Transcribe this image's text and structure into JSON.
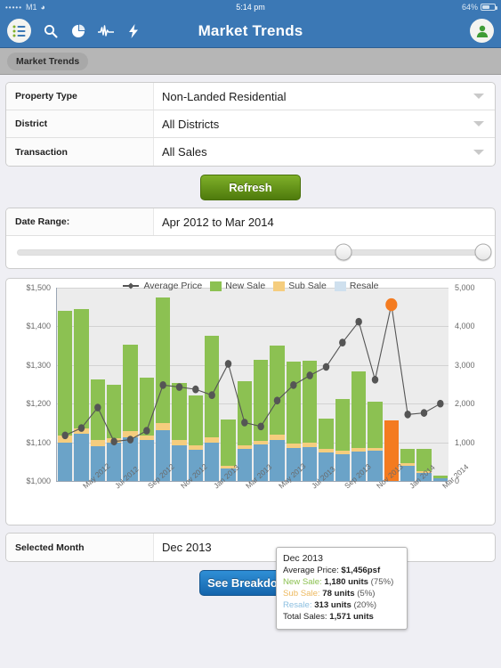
{
  "statusbar": {
    "signal_dots": "•••••",
    "carrier": "M1",
    "wifi_icon": "wifi-icon",
    "time": "5:14 pm",
    "battery_percent": "64%",
    "battery_level": 64
  },
  "navbar": {
    "title": "Market Trends",
    "menu_icon": "list-menu-icon",
    "icons": [
      {
        "name": "search-icon"
      },
      {
        "name": "pie-chart-icon"
      },
      {
        "name": "activity-pulse-icon"
      },
      {
        "name": "lightning-bolt-icon"
      }
    ],
    "avatar_icon": "user-avatar-icon",
    "bg_color": "#3b78b5"
  },
  "breadcrumb": {
    "label": "Market Trends"
  },
  "filters": {
    "rows": [
      {
        "label": "Property Type",
        "value": "Non-Landed Residential"
      },
      {
        "label": "District",
        "value": "All Districts"
      },
      {
        "label": "Transaction",
        "value": "All Sales"
      }
    ]
  },
  "refresh_button": {
    "label": "Refresh",
    "color": "#7fb029"
  },
  "date_range": {
    "label": "Date Range:",
    "value": "Apr 2012 to Mar 2014",
    "slider_left_percent": 70,
    "slider_right_percent": 100
  },
  "tooltip": {
    "month": "Dec 2013",
    "average_price_label": "Average Price:",
    "average_price_value": "$1,456psf",
    "new_sale_label": "New Sale:",
    "new_sale_value": "1,180 units",
    "new_sale_pct": "(75%)",
    "sub_sale_label": "Sub Sale:",
    "sub_sale_value": "78 units",
    "sub_sale_pct": "(5%)",
    "resale_label": "Resale:",
    "resale_value": "313 units",
    "resale_pct": "(20%)",
    "total_label": "Total Sales:",
    "total_value": "1,571 units"
  },
  "selected_month": {
    "label": "Selected Month",
    "value": "Dec 2013"
  },
  "breakdown_button": {
    "label": "See Breakdown",
    "color": "#1f7ec4"
  },
  "chart_data": {
    "type": "bar",
    "title": "",
    "xlabel": "",
    "ylabel": "",
    "y_left": {
      "ticks": [
        "$1,000",
        "$1,100",
        "$1,200",
        "$1,300",
        "$1,400",
        "$1,500"
      ],
      "min": 1000,
      "max": 1500
    },
    "y_right": {
      "ticks": [
        "0",
        "1,000",
        "2,000",
        "3,000",
        "4,000",
        "5,000"
      ],
      "min": 0,
      "max": 5000
    },
    "grid": true,
    "legend_position": "top-center",
    "legend": [
      {
        "name": "Average Price",
        "color": "#555555",
        "kind": "line"
      },
      {
        "name": "New Sale",
        "color": "#8cc152",
        "kind": "bar"
      },
      {
        "name": "Sub Sale",
        "color": "#f5cd7e",
        "kind": "bar"
      },
      {
        "name": "Resale",
        "color": "#cfe0ee",
        "kind": "bar"
      }
    ],
    "highlight_color": "#f47b20",
    "highlight_category": "Dec 2013",
    "categories": [
      "Apr 2012",
      "May 2012",
      "Jun 2012",
      "Jul 2012",
      "Aug 2012",
      "Sep 2012",
      "Oct 2012",
      "Nov 2012",
      "Dec 2012",
      "Jan 2013",
      "Feb 2013",
      "Mar 2013",
      "Apr 2013",
      "May 2013",
      "Jun 2013",
      "Jul 2013",
      "Aug 2013",
      "Sep 2013",
      "Oct 2013",
      "Nov 2013",
      "Dec 2013",
      "Jan 2014",
      "Feb 2014",
      "Mar 2014"
    ],
    "x_tick_labels": [
      "May 2012",
      "Jul 2012",
      "Sep 2012",
      "Nov 2012",
      "Jan 2013",
      "Mar 2013",
      "May 2013",
      "Jul 2013",
      "Sep 2013",
      "Nov 2013",
      "Jan 2014",
      "Mar 2014"
    ],
    "x_tick_indices": [
      1,
      3,
      5,
      7,
      9,
      11,
      13,
      15,
      17,
      19,
      21,
      23
    ],
    "series": [
      {
        "name": "Resale",
        "color": "#6ba3c8",
        "values": [
          1000,
          1220,
          910,
          980,
          1140,
          1050,
          1320,
          920,
          810,
          1000,
          330,
          830,
          950,
          1060,
          860,
          870,
          740,
          700,
          760,
          780,
          313,
          400,
          200,
          60
        ]
      },
      {
        "name": "Sub Sale",
        "color": "#f5cd7e",
        "values": [
          170,
          130,
          150,
          130,
          140,
          130,
          170,
          130,
          120,
          140,
          60,
          100,
          90,
          130,
          110,
          110,
          100,
          90,
          90,
          80,
          78,
          70,
          55,
          20
        ]
      },
      {
        "name": "New Sale",
        "color": "#8cc152",
        "values": [
          3230,
          3100,
          1570,
          1380,
          2250,
          1500,
          3260,
          1480,
          1290,
          2610,
          1190,
          1650,
          2090,
          2310,
          2110,
          2120,
          780,
          1330,
          1980,
          1180,
          1180,
          360,
          580,
          50
        ]
      },
      {
        "name": "Total Sales",
        "color": "#f47b20",
        "values": [
          4400,
          4450,
          2630,
          2490,
          3530,
          2680,
          4750,
          2530,
          2220,
          3750,
          1580,
          2580,
          3130,
          3500,
          3080,
          3100,
          1620,
          2120,
          2830,
          2040,
          1571,
          830,
          835,
          130
        ]
      }
    ],
    "average_price": {
      "name": "Average Price",
      "color": "#555555",
      "unit": "psf",
      "values": [
        1118,
        1137,
        1190,
        1102,
        1107,
        1130,
        1248,
        1243,
        1237,
        1222,
        1303,
        1151,
        1141,
        1208,
        1248,
        1273,
        1295,
        1358,
        1412,
        1262,
        1456,
        1172,
        1176,
        1200
      ]
    }
  }
}
